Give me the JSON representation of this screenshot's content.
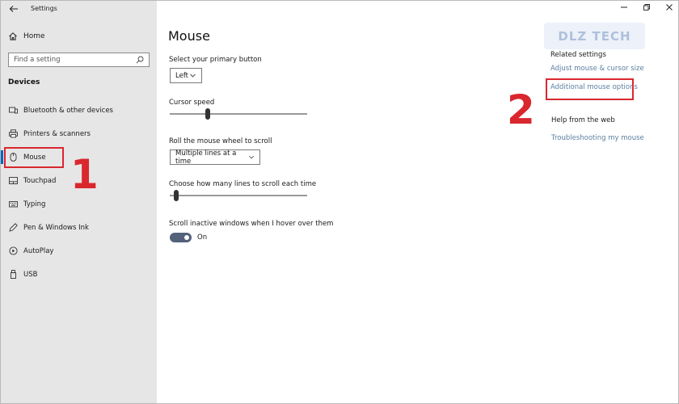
{
  "app": {
    "title": "Settings"
  },
  "sidebar": {
    "home_label": "Home",
    "search_placeholder": "Find a setting",
    "section_label": "Devices",
    "items": [
      {
        "label": "Bluetooth & other devices",
        "icon": "bluetooth-devices-icon"
      },
      {
        "label": "Printers & scanners",
        "icon": "printer-icon"
      },
      {
        "label": "Mouse",
        "icon": "mouse-icon",
        "selected": true
      },
      {
        "label": "Touchpad",
        "icon": "touchpad-icon"
      },
      {
        "label": "Typing",
        "icon": "keyboard-icon"
      },
      {
        "label": "Pen & Windows Ink",
        "icon": "pen-icon"
      },
      {
        "label": "AutoPlay",
        "icon": "autoplay-icon"
      },
      {
        "label": "USB",
        "icon": "usb-icon"
      }
    ]
  },
  "main": {
    "title": "Mouse",
    "primary_button_label": "Select your primary button",
    "primary_button_value": "Left",
    "cursor_speed_label": "Cursor speed",
    "cursor_speed_level": 0.27,
    "scroll_wheel_label": "Roll the mouse wheel to scroll",
    "scroll_wheel_value": "Multiple lines at a time",
    "lines_label": "Choose how many lines to scroll each time",
    "lines_level": 0.03,
    "inactive_scroll_label": "Scroll inactive windows when I hover over them",
    "inactive_scroll_state": "On"
  },
  "related": {
    "title": "Related settings",
    "links": [
      "Adjust mouse & cursor size",
      "Additional mouse options"
    ],
    "help_title": "Help from the web",
    "help_links": [
      "Troubleshooting my mouse"
    ]
  },
  "annotations": {
    "step1": "1",
    "step2": "2"
  },
  "watermark": "DLZ TECH",
  "colors": {
    "accent": "#0067c0",
    "highlight": "#d9272e",
    "toggle_on": "#53617a",
    "link": "#5a7fa0",
    "sidebar_bg": "#e6e6e6"
  }
}
